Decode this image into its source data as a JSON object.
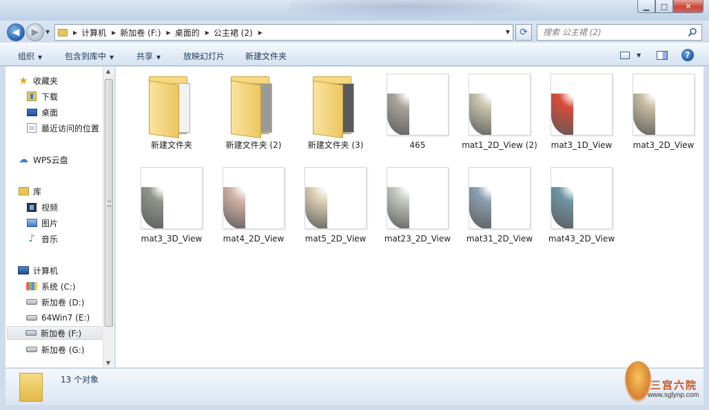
{
  "window": {
    "minimize_glyph": "▁",
    "maximize_glyph": "□",
    "close_glyph": "✕"
  },
  "address": {
    "crumbs": [
      "计算机",
      "新加卷 (F:)",
      "桌面的",
      "公主裙 (2)"
    ]
  },
  "search": {
    "placeholder": "搜索 公主裙 (2)"
  },
  "toolbar": {
    "organize": "组织",
    "include_library": "包含到库中",
    "share": "共享",
    "slideshow": "放映幻灯片",
    "new_folder": "新建文件夹"
  },
  "nav": {
    "favorites": "收藏夹",
    "downloads": "下载",
    "desktop": "桌面",
    "recent": "最近访问的位置",
    "wps": "WPS云盘",
    "library": "库",
    "videos": "视频",
    "pictures": "图片",
    "music": "音乐",
    "computer": "计算机",
    "drive_c": "系统 (C:)",
    "drive_d": "新加卷 (D:)",
    "drive_e": "64Win7  (E:)",
    "drive_f": "新加卷 (F:)",
    "drive_g": "新加卷 (G:)"
  },
  "files": [
    {
      "label": "新建文件夹",
      "kind": "folder",
      "sheet": "#f2f2f2"
    },
    {
      "label": "新建文件夹 (2)",
      "kind": "folder",
      "sheet": "#9a9a9a"
    },
    {
      "label": "新建文件夹 (3)",
      "kind": "folder",
      "sheet": "#5a5a5a"
    },
    {
      "label": "465",
      "kind": "image",
      "tone": "#a9a49c"
    },
    {
      "label": "mat1_2D_View (2)",
      "kind": "image",
      "tone": "#c9c3ad"
    },
    {
      "label": "mat3_1D_View",
      "kind": "image",
      "tone": "#d84a3a"
    },
    {
      "label": "mat3_2D_View",
      "kind": "image",
      "tone": "#c8bca2"
    },
    {
      "label": "mat3_3D_View",
      "kind": "image",
      "tone": "#8f948c"
    },
    {
      "label": "mat4_2D_View",
      "kind": "image",
      "tone": "#d2b3a6"
    },
    {
      "label": "mat5_2D_View",
      "kind": "image",
      "tone": "#ddd2b4"
    },
    {
      "label": "mat23_2D_View",
      "kind": "image",
      "tone": "#c4c8be"
    },
    {
      "label": "mat31_2D_View",
      "kind": "image",
      "tone": "#8aa0b0"
    },
    {
      "label": "mat43_2D_View",
      "kind": "image",
      "tone": "#6f95a4"
    }
  ],
  "status": {
    "count_text": "13 个对象"
  },
  "watermark": {
    "title": "三宫六院",
    "url": "www.sglynp.com"
  }
}
